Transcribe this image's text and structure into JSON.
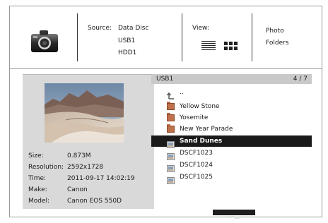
{
  "header": {
    "source_label": "Source:",
    "sources": [
      "Data Disc",
      "USB1",
      "HDD1"
    ],
    "view_label": "View:",
    "view_modes": [
      "list",
      "grid"
    ],
    "media_types": [
      "Photo",
      "Folders"
    ],
    "icons": {
      "camera": "camera-icon",
      "list_view": "list-view-icon",
      "grid_view": "grid-view-icon"
    }
  },
  "info": {
    "rows": [
      {
        "key": "Size:",
        "value": "0.873M"
      },
      {
        "key": "Resolution:",
        "value": "2592x1728"
      },
      {
        "key": "Time:",
        "value": "2011-09-17 14:02:19"
      },
      {
        "key": "Make:",
        "value": "Canon"
      },
      {
        "key": "Model:",
        "value": "Canon EOS 550D"
      }
    ]
  },
  "browser": {
    "path": "USB1",
    "position": "4 / 7",
    "up_label": "..",
    "items": [
      {
        "name": "Yellow Stone",
        "type": "folder",
        "icon": "folder-icon"
      },
      {
        "name": "Yosemite",
        "type": "folder",
        "icon": "folder-icon"
      },
      {
        "name": "New Year Parade",
        "type": "folder",
        "icon": "folder-icon"
      },
      {
        "name": "Sand Dunes",
        "type": "photo",
        "icon": "photo-file-icon",
        "selected": true
      },
      {
        "name": "DSCF1023",
        "type": "photo",
        "icon": "photo-file-icon"
      },
      {
        "name": "DSCF1024",
        "type": "photo",
        "icon": "photo-file-icon"
      },
      {
        "name": "DSCF1025",
        "type": "photo",
        "icon": "photo-file-icon"
      }
    ]
  },
  "colors": {
    "selection": "#1a1a1a",
    "panel": "#d9d9d9",
    "folder": "#c0704a"
  }
}
